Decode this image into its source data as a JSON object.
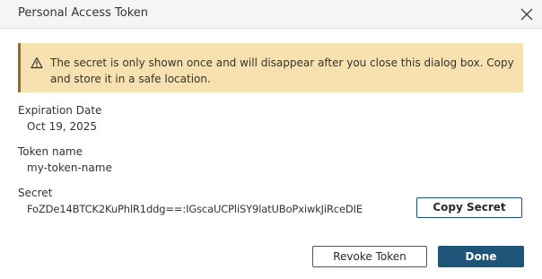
{
  "dialog": {
    "title": "Personal Access Token"
  },
  "banner": {
    "text": "The secret is only shown once and will disappear after you close this dialog box. Copy and store it in a safe location."
  },
  "fields": {
    "expiration_label": "Expiration Date",
    "expiration_value": "Oct 19, 2025",
    "token_name_label": "Token name",
    "token_name_value": "my-token-name",
    "secret_label": "Secret",
    "secret_value": "FoZDe14BTCK2KuPhlR1ddg==:IGscaUCPliSY9latUBoPxiwkJiRceDIE"
  },
  "buttons": {
    "copy_secret": "Copy Secret",
    "revoke_token": "Revoke Token",
    "done": "Done"
  },
  "colors": {
    "banner_background": "#f8e1b0",
    "banner_border": "#8a6d3b",
    "primary_button": "#1f5578",
    "title_bar": "#f5f5f5"
  },
  "icons": {
    "warning": "warning-icon",
    "close": "close-icon"
  }
}
